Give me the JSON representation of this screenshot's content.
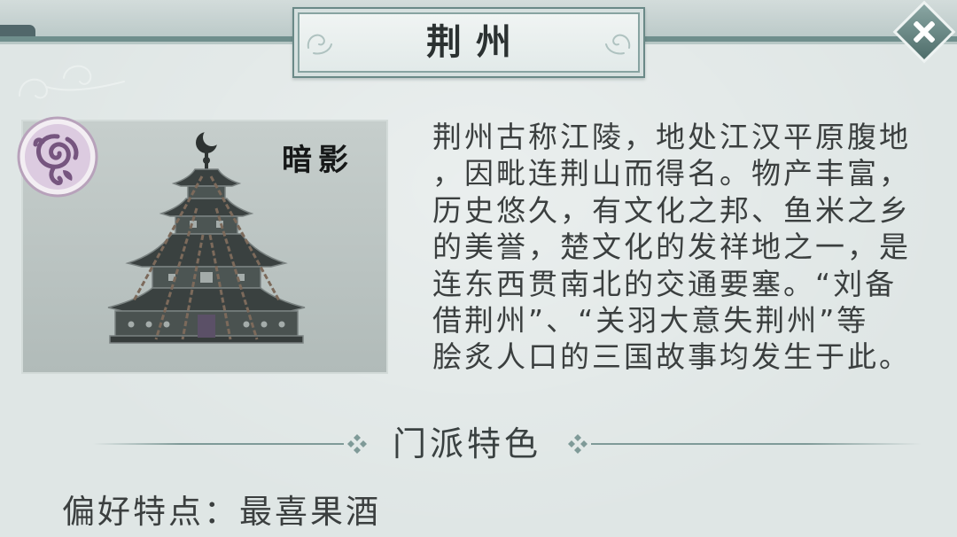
{
  "header": {
    "title": "荆州"
  },
  "close_button": {
    "icon": "close-icon"
  },
  "location_card": {
    "faction_name": "暗影",
    "emblem_icon": "rose-emblem-icon",
    "illustration_icon": "hanging-pagoda-illustration"
  },
  "description": {
    "lines": [
      "荆州古称江陵，地处江汉平原腹地",
      "，因毗连荆山而得名。物产丰富，",
      "历史悠久，有文化之邦、鱼米之乡",
      "的美誉，楚文化的发祥地之一，是",
      "连东西贯南北的交通要塞。“刘备",
      "借荆州”、“关羽大意失荆州”等",
      "脍炙人口的三国故事均发生于此。"
    ]
  },
  "section": {
    "title": "门派特色"
  },
  "traits": {
    "preference_label": "偏好特点：",
    "preference_value": "最喜果酒"
  },
  "colors": {
    "background": "#dfe6e5",
    "accent": "#6f8e8c",
    "text": "#3b3f3f",
    "emblem": "#76557f"
  }
}
